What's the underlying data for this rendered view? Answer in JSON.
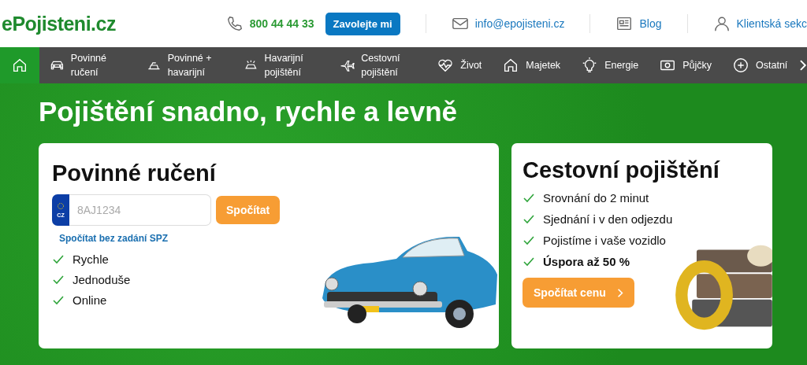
{
  "header": {
    "logo": "ePojisteni.cz",
    "phone": "800 44 44 33",
    "callback_button": "Zavolejte mi",
    "email": "info@epojisteni.cz",
    "blog": "Blog",
    "client_section": "Klientská sekc"
  },
  "nav": {
    "items": [
      {
        "selected": true
      },
      {
        "label": "Povinné ručení",
        "selected": false
      },
      {
        "label": "Povinné + havarijní",
        "selected": false
      },
      {
        "label": "Havarijní pojištění",
        "selected": false
      },
      {
        "label": "Cestovní pojištění",
        "selected": false
      },
      {
        "label": "Život",
        "selected": false
      },
      {
        "label": "Majetek",
        "selected": false
      },
      {
        "label": "Energie",
        "selected": false
      },
      {
        "label": "Půjčky",
        "selected": false
      },
      {
        "label": "Ostatní",
        "selected": false
      }
    ]
  },
  "hero": {
    "title": "Pojištění snadno, rychle a levně"
  },
  "liability_card": {
    "title": "Povinné ručení",
    "plate_country": "CZ",
    "plate_placeholder": "8AJ1234",
    "calculate_button": "Spočítat",
    "no_plate_link": "Spočítat bez zadání SPZ",
    "benefits": [
      "Rychle",
      "Jednoduše",
      "Online"
    ]
  },
  "travel_card": {
    "title": "Cestovní pojištění",
    "benefits": [
      {
        "text": "Srovnání do 2 minut",
        "bold": false
      },
      {
        "text": "Sjednání i v den odjezdu",
        "bold": false
      },
      {
        "text": "Pojistíme i vaše vozidlo",
        "bold": false
      },
      {
        "text": "Úspora až 50 %",
        "bold": true
      }
    ],
    "button": "Spočítat cenu"
  }
}
